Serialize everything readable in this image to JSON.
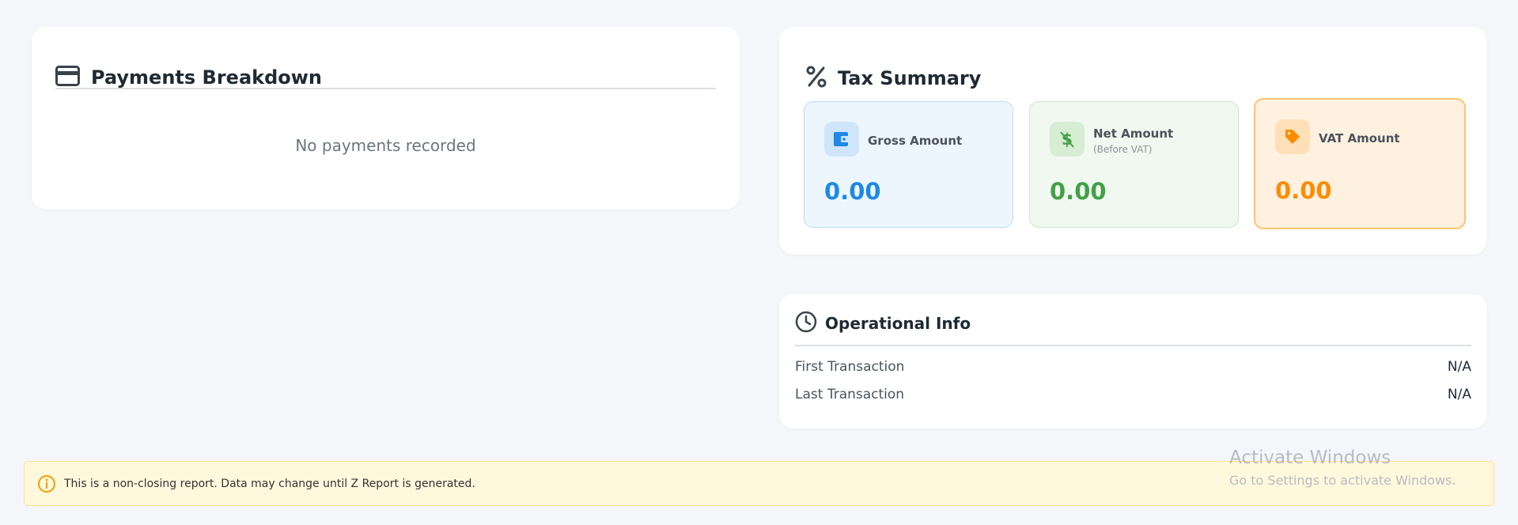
{
  "payments": {
    "title": "Payments Breakdown",
    "empty_text": "No payments recorded"
  },
  "tax_summary": {
    "title": "Tax Summary",
    "gross": {
      "label": "Gross Amount",
      "value": "0.00",
      "icon": "wallet-icon",
      "color": "#1e88e5"
    },
    "net": {
      "label": "Net Amount",
      "sublabel": "(Before VAT)",
      "value": "0.00",
      "icon": "dollar-icon",
      "color": "#43a047"
    },
    "vat": {
      "label": "VAT Amount",
      "value": "0.00",
      "icon": "tag-icon",
      "color": "#fb8c00"
    }
  },
  "operational_info": {
    "title": "Operational Info",
    "rows": [
      {
        "label": "First Transaction",
        "value": "N/A"
      },
      {
        "label": "Last Transaction",
        "value": "N/A"
      }
    ]
  },
  "banner": {
    "text": "This is a non-closing report. Data may change until Z Report is generated.",
    "icon": "info-icon",
    "color": "#f0a000"
  },
  "watermark": {
    "line1": "Activate Windows",
    "line2": "Go to Settings to activate Windows."
  }
}
